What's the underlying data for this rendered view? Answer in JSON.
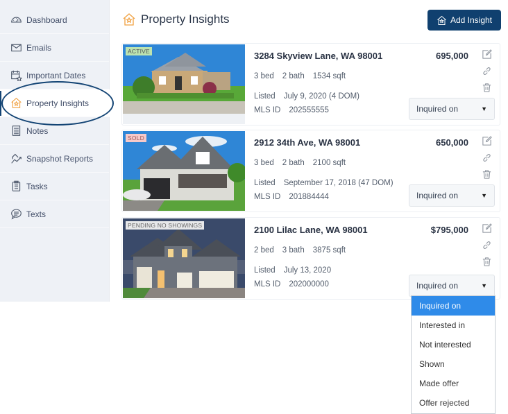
{
  "sidebar": {
    "items": [
      {
        "label": "Dashboard",
        "icon": "dashboard-gauge-icon"
      },
      {
        "label": "Emails",
        "icon": "envelope-icon"
      },
      {
        "label": "Important Dates",
        "icon": "calendar-icon"
      },
      {
        "label": "Property Insights",
        "icon": "house-star-icon",
        "active": true
      },
      {
        "label": "Notes",
        "icon": "notes-icon"
      },
      {
        "label": "Snapshot Reports",
        "icon": "snapshot-chart-icon"
      },
      {
        "label": "Tasks",
        "icon": "clipboard-icon"
      },
      {
        "label": "Texts",
        "icon": "chat-bubble-icon"
      }
    ]
  },
  "header": {
    "title": "Property Insights",
    "add_button": "Add Insight"
  },
  "colors": {
    "primary": "#10406f",
    "accent_orange": "#f0a040",
    "selected_option": "#2f8be9",
    "badge_active": "#bde3b0",
    "badge_sold": "#f6c9c9"
  },
  "properties": [
    {
      "status": "ACTIVE",
      "address": "3284 Skyview Lane, WA 98001",
      "price": "695,000",
      "beds": "3 bed",
      "baths": "2 bath",
      "sqft": "1534 sqft",
      "listed_label": "Listed",
      "listed": "July 9, 2020 (4 DOM)",
      "mls_label": "MLS ID",
      "mls": "202555555",
      "interest": "Inquired on"
    },
    {
      "status": "SOLD",
      "address": "2912 34th Ave, WA 98001",
      "price": "650,000",
      "beds": "3 bed",
      "baths": "2 bath",
      "sqft": "2100 sqft",
      "listed_label": "Listed",
      "listed": "September 17, 2018 (47 DOM)",
      "mls_label": "MLS ID",
      "mls": "201884444",
      "interest": "Inquired on"
    },
    {
      "status": "PENDING NO SHOWINGS",
      "address": "2100 Lilac Lane, WA 98001",
      "price": "$795,000",
      "beds": "2 bed",
      "baths": "3 bath",
      "sqft": "3875 sqft",
      "listed_label": "Listed",
      "listed": "July 13, 2020",
      "mls_label": "MLS ID",
      "mls": "202000000",
      "interest": "Inquired on"
    }
  ],
  "dropdown": {
    "selected": "Inquired on",
    "options": [
      "Inquired on",
      "Interested in",
      "Not interested",
      "Shown",
      "Made offer",
      "Offer rejected"
    ]
  }
}
